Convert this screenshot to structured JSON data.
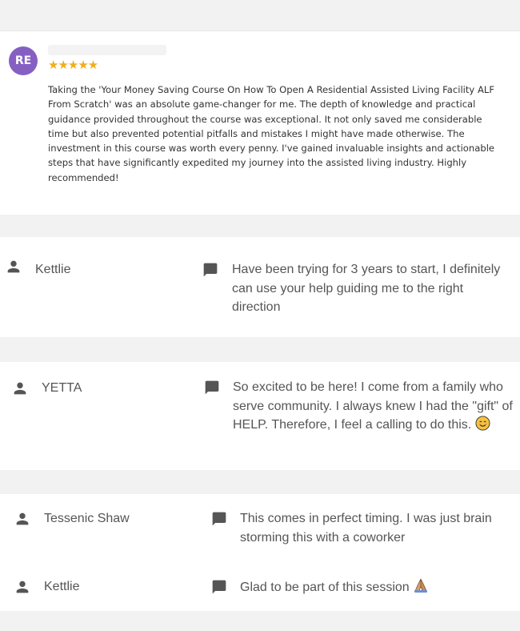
{
  "review": {
    "avatar_initials": "RE",
    "stars": "★★★★★",
    "text": "Taking the 'Your Money Saving Course On How To Open A Residential Assisted Living Facility ALF From Scratch' was an absolute game-changer for me. The depth of knowledge and practical guidance provided throughout the course was exceptional. It not only saved me considerable time but also prevented potential pitfalls and mistakes I might have made otherwise. The investment in this course was worth every penny. I've gained invaluable insights and actionable steps that have significantly expedited my journey into the assisted living industry. Highly recommended!"
  },
  "comments": [
    {
      "name": "Kettlie",
      "message": "Have been trying for 3 years to start, I definitely can use your help guiding me to the right direction"
    },
    {
      "name": "YETTA",
      "message": "So excited to be here! I come from a family who serve community. I always knew I had the \"gift\" of HELP. Therefore, I feel a calling to do this."
    },
    {
      "name": "Tessenic Shaw",
      "message": "This comes in perfect timing. I was just brain storming this with a coworker"
    },
    {
      "name": "Kettlie",
      "message": "Glad to be part of this session"
    }
  ],
  "icons": {
    "person": "person-icon",
    "chat": "chat-bubble-icon",
    "smile": "smiling-face-emoji",
    "pray": "folded-hands-emoji"
  },
  "colors": {
    "avatar": "#8560c2",
    "stars": "#f0ad1c",
    "text": "#555555",
    "background": "#f2f2f2"
  }
}
